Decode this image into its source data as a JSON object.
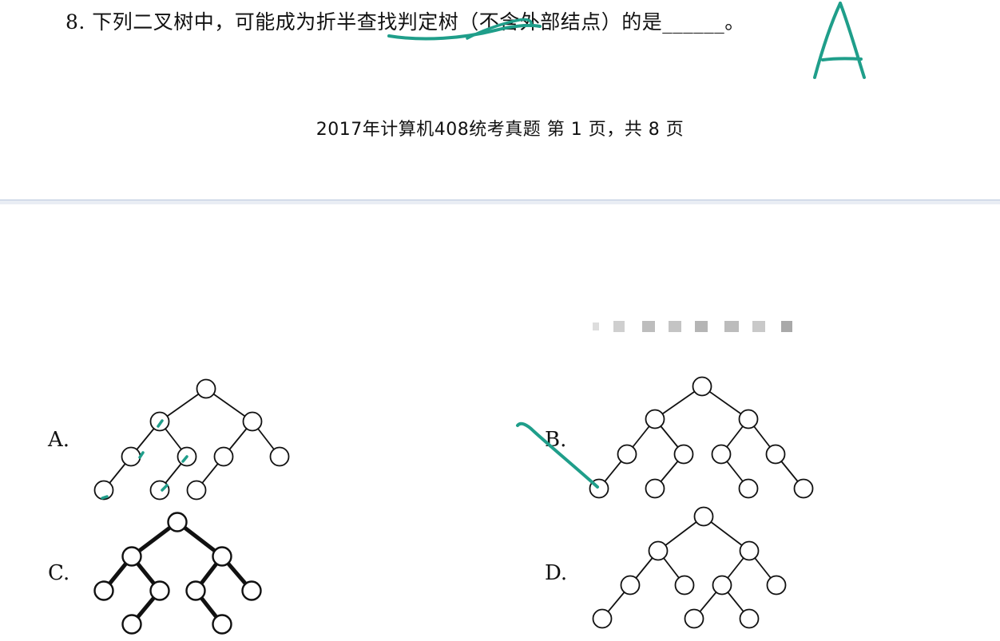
{
  "question": {
    "text": "8. 下列二叉树中，可能成为折半查找判定树（不含外部结点）的是______。"
  },
  "footer": {
    "text": "2017年计算机408统考真题 第 1 页，共 8 页"
  },
  "options": [
    {
      "label": "A."
    },
    {
      "label": "B."
    },
    {
      "label": "C."
    },
    {
      "label": "D."
    }
  ],
  "handwritten_answer": "A",
  "ink_color": "#1f9e8a"
}
